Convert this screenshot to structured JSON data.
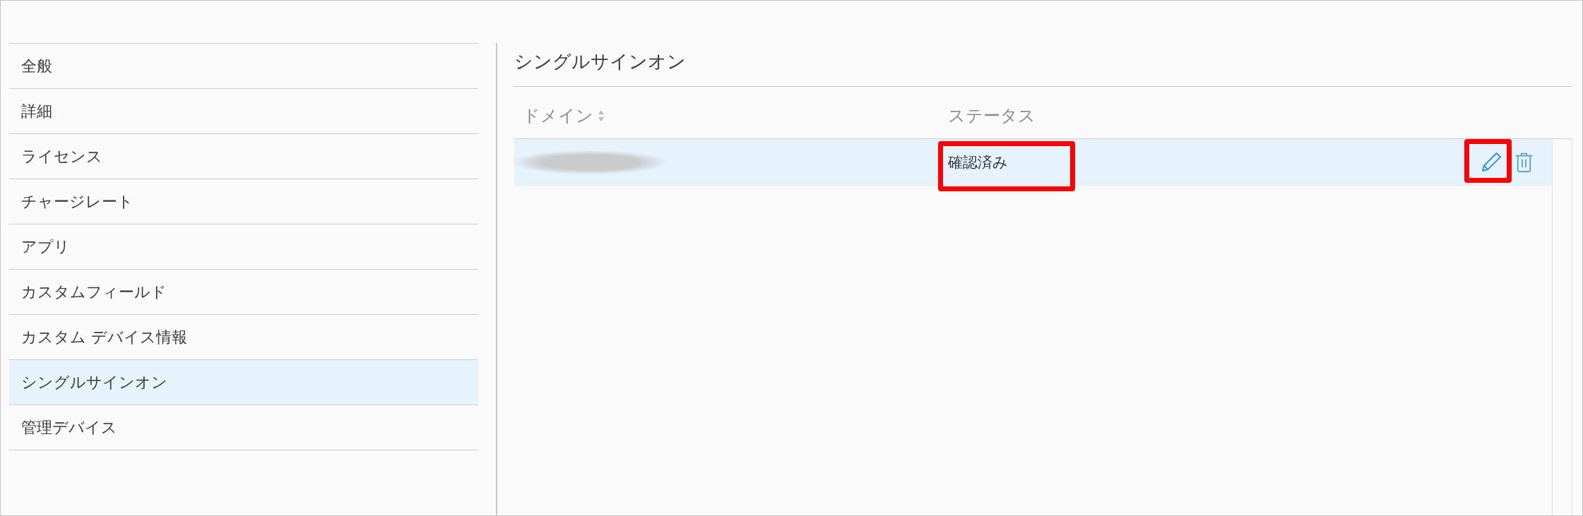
{
  "sidebar": {
    "items": [
      {
        "label": "全般",
        "selected": false
      },
      {
        "label": "詳細",
        "selected": false
      },
      {
        "label": "ライセンス",
        "selected": false
      },
      {
        "label": "チャージレート",
        "selected": false
      },
      {
        "label": "アプリ",
        "selected": false
      },
      {
        "label": "カスタムフィールド",
        "selected": false
      },
      {
        "label": "カスタム デバイス情報",
        "selected": false
      },
      {
        "label": "シングルサインオン",
        "selected": true
      },
      {
        "label": "管理デバイス",
        "selected": false
      }
    ]
  },
  "main": {
    "title": "シングルサインオン",
    "table": {
      "columns": [
        {
          "label": "ドメイン",
          "sortable": true
        },
        {
          "label": "ステータス",
          "sortable": false
        }
      ],
      "rows": [
        {
          "selected": true,
          "domain_redacted": true,
          "status": "確認済み",
          "status_highlighted": true,
          "actions": [
            {
              "kind": "edit",
              "highlighted": true
            },
            {
              "kind": "delete",
              "highlighted": false
            }
          ]
        }
      ]
    }
  }
}
